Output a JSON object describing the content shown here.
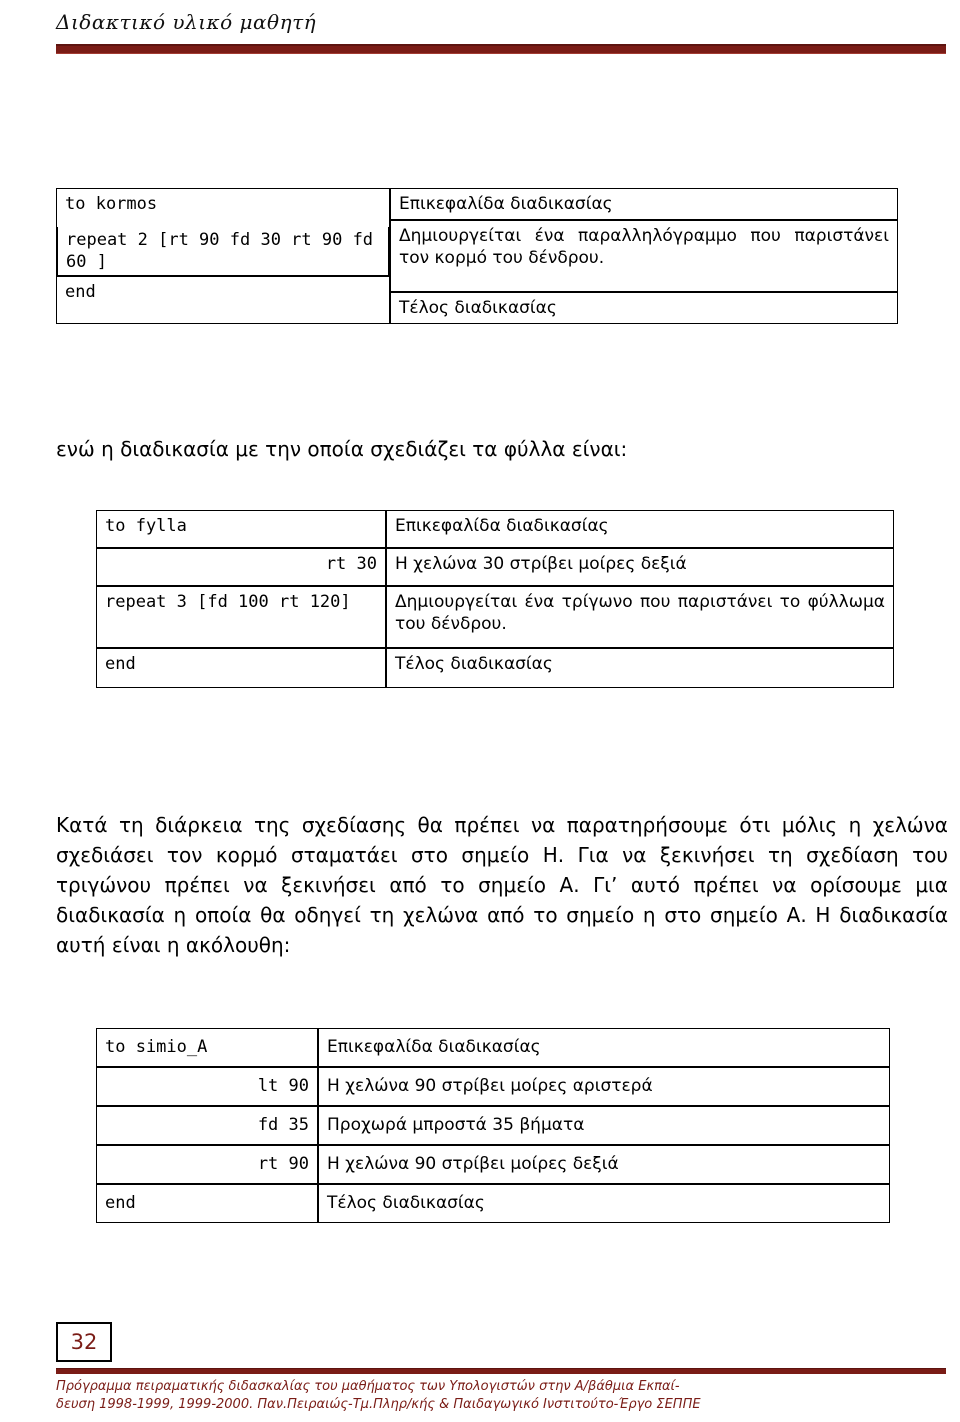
{
  "header": {
    "title": "Διδακτικό υλικό μαθητή"
  },
  "procedures": [
    {
      "name": "kormos-procedure",
      "code": [
        "to kormos",
        "repeat 2 [rt 90 fd 30 rt 90 fd 60 ]",
        "end"
      ],
      "comments": [
        "Επικεφαλίδα διαδικασίας",
        "Δημιουργείται ένα παραλληλόγραμμο που παριστάνει τον κορμό του δένδρου.",
        "Τέλος διαδικασίας"
      ]
    },
    {
      "name": "fylla-procedure",
      "code": [
        "to fylla",
        "rt 30",
        "repeat 3 [fd 100 rt 120]",
        "end"
      ],
      "comments": [
        "Επικεφαλίδα διαδικασίας",
        "Η χελώνα 30 στρίβει μοίρες δεξιά",
        "Δημιουργείται ένα τρίγωνο που παριστάνει το φύλλωμα του δένδρου.",
        "Τέλος διαδικασίας"
      ]
    },
    {
      "name": "simio-A-procedure",
      "code": [
        "to simio_A",
        "lt 90",
        "fd 35",
        "rt 90",
        "end"
      ],
      "comments": [
        "Επικεφαλίδα διαδικασίας",
        "Η χελώνα 90 στρίβει μοίρες αριστερά",
        "Προχωρά μπροστά 35 βήματα",
        "Η χελώνα 90 στρίβει μοίρες δεξιά",
        "Τέλος διαδικασίας"
      ]
    }
  ],
  "paragraphs": {
    "intro": "ενώ η διαδικασία με την οποία σχεδιάζει τα φύλλα είναι:",
    "body": "Κατά τη διάρκεια της σχεδίασης θα πρέπει να παρατηρήσουμε ότι μόλις η χελώνα σχεδιάσει τον κορμό σταματάει στο σημείο Η. Για να ξεκινήσει τη σχεδίαση του τριγώνου πρέπει να ξεκινήσει από το σημείο Α. Γι’ αυτό πρέπει να ορίσουμε μια διαδικασία η οποία θα οδηγεί τη χελώνα από το σημείο η στο σημείο Α. Η διαδικασία αυτή είναι η ακόλουθη:"
  },
  "footer": {
    "page_number": "32",
    "line1": "Πρόγραμμα πειραματικής διδασκαλίας του μαθήματος των Υπολογιστών στην Α/βάθμια Εκπαί-",
    "line2": "δευση 1998-1999, 1999-2000. Παν.Πειραιώς-Τμ.Πληρ/κής & Παιδαγωγικό Ινστιτούτο-Έργο ΣΕΠΠΕ"
  },
  "colors": {
    "accent": "#7a1c16",
    "text": "#000000"
  }
}
